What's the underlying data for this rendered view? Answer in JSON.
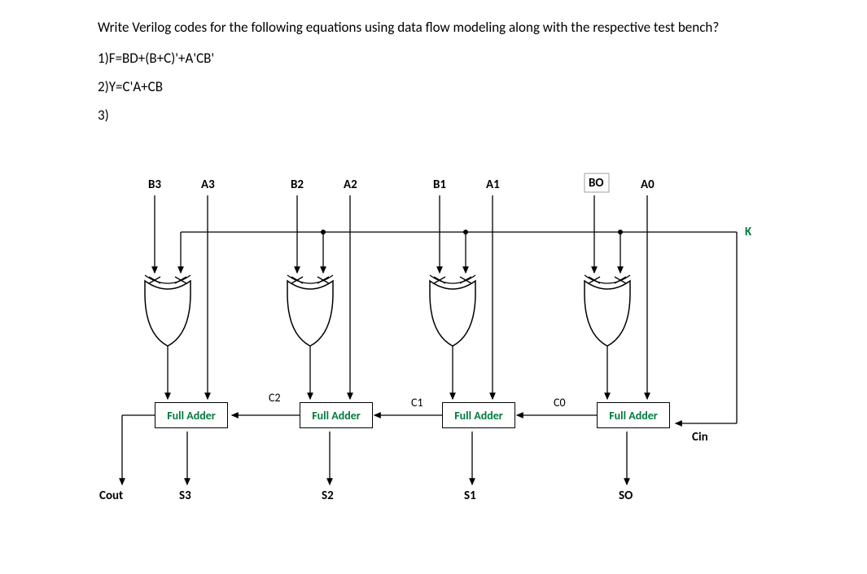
{
  "question": {
    "prompt": "Write Verilog codes for the following equations using data flow modeling along with the respective test bench?",
    "equations": {
      "eq1": "1)F=BD+(B+C)'+A'CB'",
      "eq2": "2)Y=C'A+CB",
      "eq3": "3)"
    }
  },
  "diagram": {
    "type": "circuit-schematic",
    "description": "4-bit Adder/Subtractor with XOR gates and Full Adders",
    "inputs": {
      "b3": "B3",
      "a3": "A3",
      "b2": "B2",
      "a2": "A2",
      "b1": "B1",
      "a1": "A1",
      "b0": "BO",
      "a0": "A0",
      "k": "K"
    },
    "internal_wires": {
      "c2": "C2",
      "c1": "C1",
      "c0": "C0",
      "cin": "Cin"
    },
    "outputs": {
      "cout": "Cout",
      "s3": "S3",
      "s2": "S2",
      "s1": "S1",
      "s0": "SO"
    },
    "blocks": {
      "fa3": "Full Adder",
      "fa2": "Full Adder",
      "fa1": "Full Adder",
      "fa0": "Full Adder"
    },
    "structure": {
      "stages": [
        {
          "bit": 3,
          "inputs": [
            "B3",
            "A3"
          ],
          "xor_with": "K",
          "block": "Full Adder",
          "carry_in": "C2",
          "sum_out": "S3",
          "carry_out": "Cout"
        },
        {
          "bit": 2,
          "inputs": [
            "B2",
            "A2"
          ],
          "xor_with": "K",
          "block": "Full Adder",
          "carry_in": "C1",
          "sum_out": "S2",
          "carry_out": "C2"
        },
        {
          "bit": 1,
          "inputs": [
            "B1",
            "A1"
          ],
          "xor_with": "K",
          "block": "Full Adder",
          "carry_in": "C0",
          "sum_out": "S1",
          "carry_out": "C1"
        },
        {
          "bit": 0,
          "inputs": [
            "B0",
            "A0"
          ],
          "xor_with": "K",
          "block": "Full Adder",
          "carry_in": "Cin",
          "sum_out": "S0",
          "carry_out": "C0"
        }
      ]
    }
  }
}
